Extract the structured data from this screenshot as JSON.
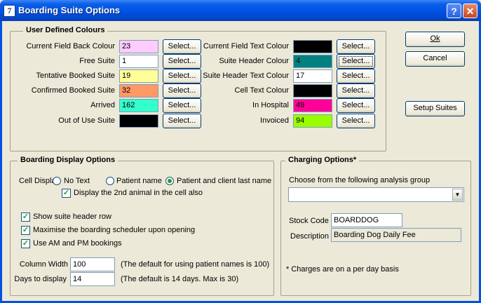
{
  "window": {
    "title": "Boarding Suite Options",
    "app_glyph": "7",
    "help_glyph": "?",
    "close_glyph": "✕"
  },
  "user_colours": {
    "group_label": "User Defined Colours",
    "select_label": "Select...",
    "left": [
      {
        "label": "Current Field Back Colour",
        "value": "23",
        "color": "#ffccff"
      },
      {
        "label": "Free Suite",
        "value": "1",
        "color": "#ffffff"
      },
      {
        "label": "Tentative Booked Suite",
        "value": "19",
        "color": "#ffff99"
      },
      {
        "label": "Confirmed Booked Suite",
        "value": "32",
        "color": "#ff9966"
      },
      {
        "label": "Arrived",
        "value": "162",
        "color": "#33ffcc"
      },
      {
        "label": "Out of Use Suite",
        "value": "",
        "color": "#000000"
      }
    ],
    "right": [
      {
        "label": "Current Field Text Colour",
        "value": "",
        "color": "#000000"
      },
      {
        "label": "Suite Header Colour",
        "value": "4",
        "color": "#008080"
      },
      {
        "label": "Suite Header Text Colour",
        "value": "17",
        "color": "#ffffff"
      },
      {
        "label": "Cell Text Colour",
        "value": "",
        "color": "#000000"
      },
      {
        "label": "In Hospital",
        "value": "49",
        "color": "#ff0099"
      },
      {
        "label": "Invoiced",
        "value": "94",
        "color": "#99ff00"
      }
    ]
  },
  "actions": {
    "ok": "Ok",
    "cancel": "Cancel",
    "setup_suites": "Setup Suites"
  },
  "display_options": {
    "group_label": "Boarding Display Options",
    "cell_display_label": "Cell Display",
    "radio_no_text": "No Text",
    "radio_patient_name": "Patient name",
    "radio_patient_client": "Patient and client last name",
    "selected_radio": "patient_client",
    "second_animal": "Display the 2nd animal in the cell also",
    "show_header": "Show suite header row",
    "maximise": "Maximise the boarding scheduler upon opening",
    "am_pm": "Use AM and PM bookings",
    "column_width_label": "Column Width",
    "column_width_value": "100",
    "column_width_note": "(The default for using patient names is 100)",
    "days_label": "Days to display",
    "days_value": "14",
    "days_note": "(The default is 14 days. Max is 30)",
    "check_glyph": "✓"
  },
  "charging": {
    "group_label": "Charging Options*",
    "analysis_label": "Choose from the following analysis group",
    "analysis_value": "",
    "stock_code_label": "Stock Code",
    "stock_code_value": "BOARDDOG",
    "description_label": "Description",
    "description_value": "Boarding Dog Daily Fee",
    "footnote": "* Charges are on a per day basis",
    "arrow_glyph": "▼"
  }
}
